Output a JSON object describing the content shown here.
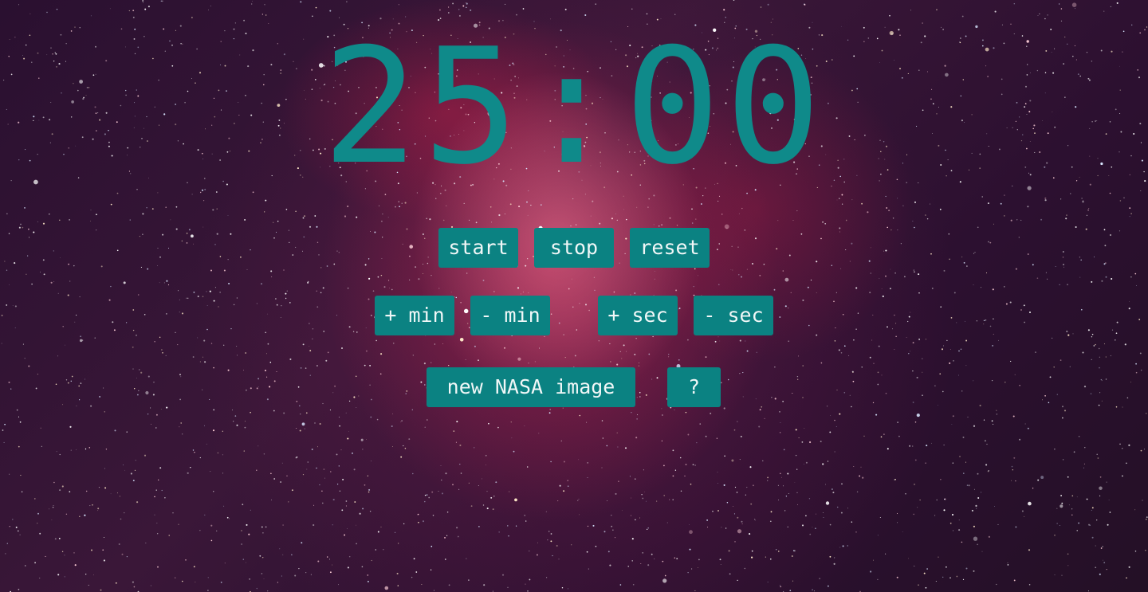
{
  "timer": {
    "display": "25:00"
  },
  "controls": {
    "start_label": "start",
    "stop_label": "stop",
    "reset_label": "reset",
    "add_min_label": "+ min",
    "sub_min_label": "- min",
    "add_sec_label": "+ sec",
    "sub_sec_label": "- sec",
    "new_image_label": "new NASA image",
    "help_label": "?"
  },
  "colors": {
    "accent": "#0b8282",
    "timer_text": "#0f8a8a",
    "button_text": "#f0f7f7"
  }
}
